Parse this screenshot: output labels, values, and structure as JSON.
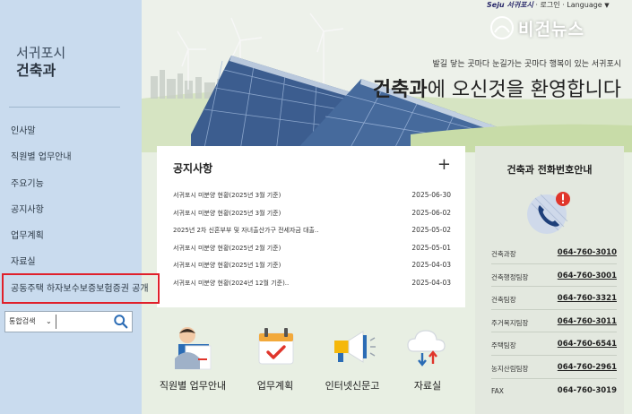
{
  "sidebar": {
    "region": "서귀포시",
    "dept": "건축과",
    "items": [
      {
        "label": "인사말"
      },
      {
        "label": "직원별 업무안내"
      },
      {
        "label": "주요기능"
      },
      {
        "label": "공지사항"
      },
      {
        "label": "업무계획"
      },
      {
        "label": "자료실"
      },
      {
        "label": "공동주택 하자보수보증보험증권 공개"
      }
    ],
    "search": {
      "scope": "통합검색",
      "value": ""
    }
  },
  "topbar": {
    "logo": "Seju 서귀포시",
    "separator1": "·",
    "login": "로그인",
    "separator2": "·",
    "language": "Language"
  },
  "watermark": "비건뉴스",
  "hero": {
    "slogan": "발길 닿는 곳마다 눈길가는 곳마다 행복이 있는 서귀포시",
    "welcome_bold": "건축과",
    "welcome_rest": "에 오신것을 환영합니다"
  },
  "notice": {
    "title": "공지사항",
    "plus": "+",
    "rows": [
      {
        "title": "서귀포시 미분양 현황(2025년 3월 기준)",
        "date": "2025-06-30"
      },
      {
        "title": "서귀포시 미분양 현황(2025년 3월 기준)",
        "date": "2025-06-02"
      },
      {
        "title": "2025년 2차 신혼부부 및 자녀출산가구 전세자금 대출..",
        "date": "2025-05-02"
      },
      {
        "title": "서귀포시 미분양 현황(2025년 2월 기준)",
        "date": "2025-05-01"
      },
      {
        "title": "서귀포시 미분양 현황(2025년 1월 기준)",
        "date": "2025-04-03"
      },
      {
        "title": "서귀포시 미분양 현황(2024년 12월 기준)..",
        "date": "2025-04-03"
      }
    ]
  },
  "phone": {
    "title": "건축과 전화번호안내",
    "rows": [
      {
        "label": "건축과장",
        "number": "064-760-3010"
      },
      {
        "label": "건축행정팀장",
        "number": "064-760-3001"
      },
      {
        "label": "건축팀장",
        "number": "064-760-3321"
      },
      {
        "label": "주거복지팀장",
        "number": "064-760-3011"
      },
      {
        "label": "주택팀장",
        "number": "064-760-6541"
      },
      {
        "label": "농지산림팀장",
        "number": "064-760-2961"
      },
      {
        "label": "FAX",
        "number": "064-760-3019"
      }
    ]
  },
  "quick": [
    {
      "label": "직원별 업무안내",
      "icon": "staff-icon"
    },
    {
      "label": "업무계획",
      "icon": "calendar-check-icon"
    },
    {
      "label": "인터넷신문고",
      "icon": "megaphone-icon"
    },
    {
      "label": "자료실",
      "icon": "cloud-download-icon"
    }
  ],
  "colors": {
    "highlight": "#e0202b",
    "sidebar": "#c9dbee",
    "accent": "#2b6cb5"
  }
}
